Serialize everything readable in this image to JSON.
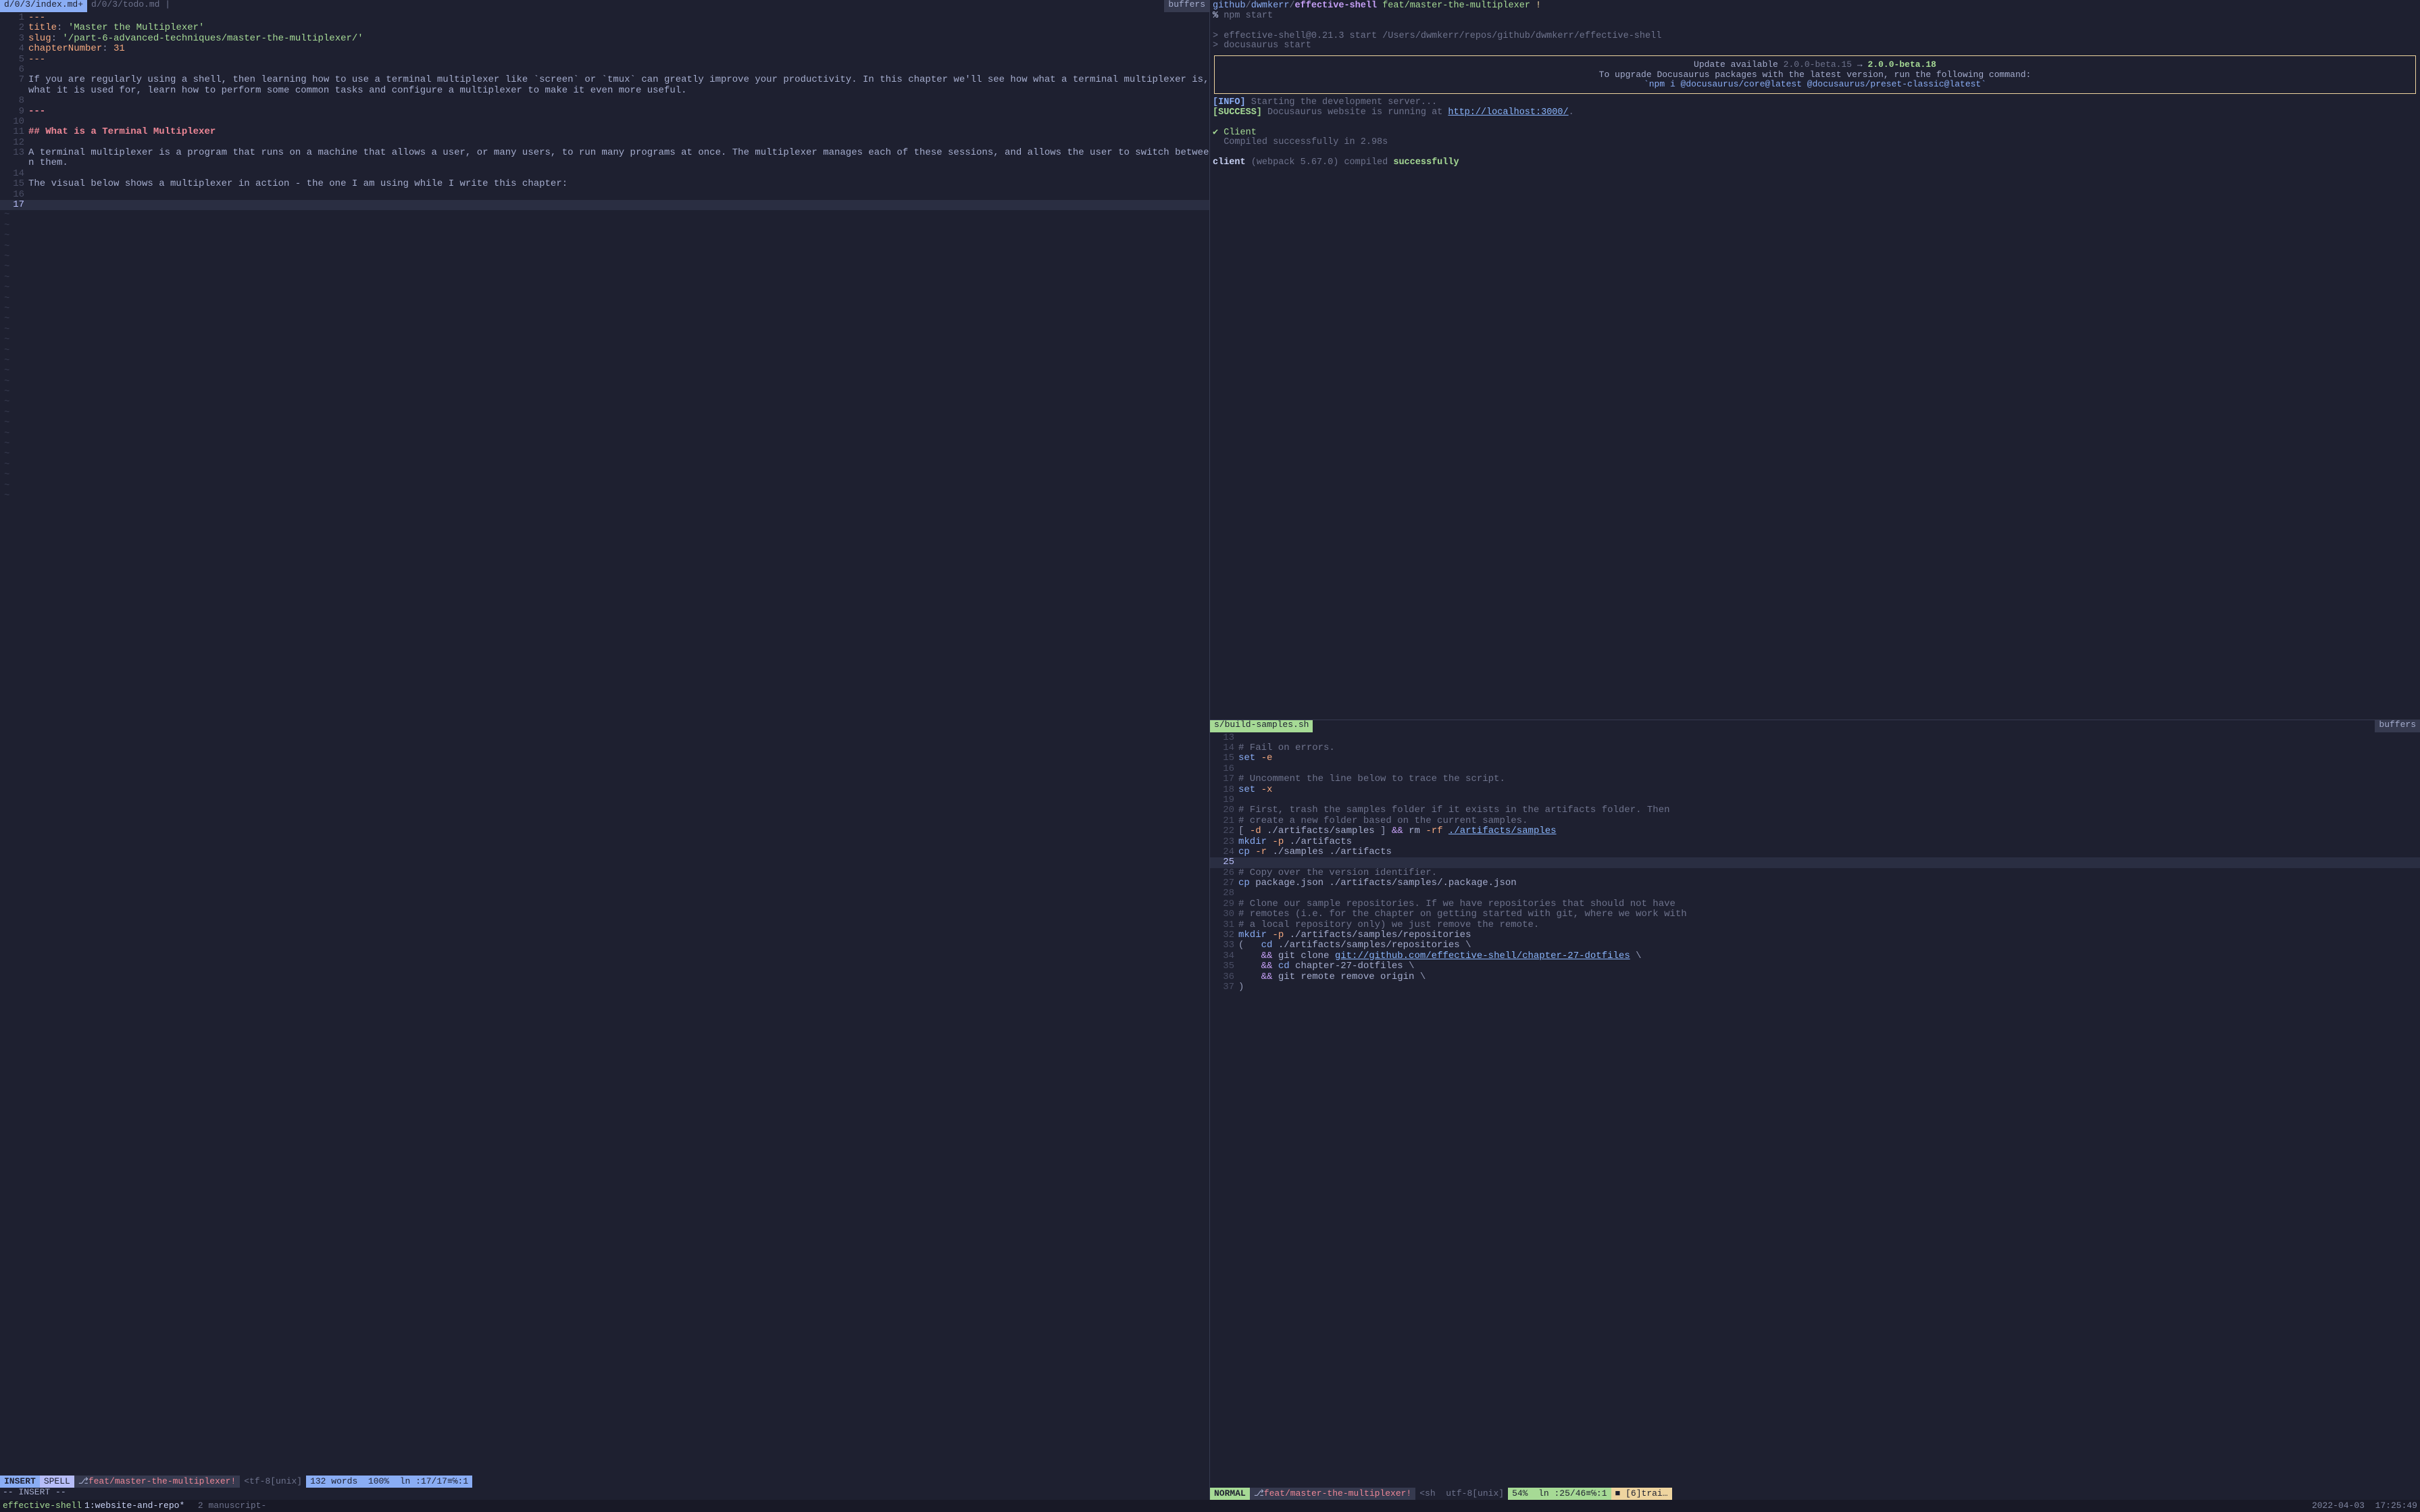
{
  "left": {
    "tabs": {
      "active": "d/0/3/index.md+",
      "other": "d/0/3/todo.md |",
      "right": "buffers"
    },
    "lines": [
      {
        "n": "1",
        "cur": false,
        "frags": [
          {
            "t": "---",
            "c": "key"
          }
        ]
      },
      {
        "n": "2",
        "cur": false,
        "frags": [
          {
            "t": "title",
            "c": "key"
          },
          {
            "t": ": ",
            "c": "pun"
          },
          {
            "t": "'Master the Multiplexer'",
            "c": "str"
          }
        ]
      },
      {
        "n": "3",
        "cur": false,
        "frags": [
          {
            "t": "slug",
            "c": "key"
          },
          {
            "t": ": ",
            "c": "pun"
          },
          {
            "t": "'/part-6-advanced-techniques/master-the-multiplexer/'",
            "c": "str"
          }
        ]
      },
      {
        "n": "4",
        "cur": false,
        "frags": [
          {
            "t": "chapterNumber",
            "c": "key"
          },
          {
            "t": ": ",
            "c": "pun"
          },
          {
            "t": "31",
            "c": "num"
          }
        ]
      },
      {
        "n": "5",
        "cur": false,
        "frags": [
          {
            "t": "---",
            "c": "key"
          }
        ]
      },
      {
        "n": "6",
        "cur": false,
        "frags": []
      },
      {
        "n": "7",
        "cur": false,
        "frags": [
          {
            "t": "If you are regularly using a shell, then learning how to use a terminal multiplexer like `screen` or `tmux` can greatly improve your productivity. In this chapter we'll see how what a terminal multiplexer is, what it is used for, learn how to perform some common tasks and configure a multiplexer to make it even more useful.",
            "c": ""
          }
        ]
      },
      {
        "n": "8",
        "cur": false,
        "frags": []
      },
      {
        "n": "9",
        "cur": false,
        "frags": [
          {
            "t": "---",
            "c": "hdr"
          }
        ]
      },
      {
        "n": "10",
        "cur": false,
        "frags": []
      },
      {
        "n": "11",
        "cur": false,
        "frags": [
          {
            "t": "## What is a Terminal Multiplexer",
            "c": "hdr"
          }
        ]
      },
      {
        "n": "12",
        "cur": false,
        "frags": []
      },
      {
        "n": "13",
        "cur": false,
        "frags": [
          {
            "t": "A terminal multiplexer is a program that runs on a machine that allows a user, or many users, to run many programs at once. The multiplexer manages each of these sessions, and allows the user to switch between them.",
            "c": ""
          }
        ]
      },
      {
        "n": "14",
        "cur": false,
        "frags": []
      },
      {
        "n": "15",
        "cur": false,
        "frags": [
          {
            "t": "The visual below shows a multiplexer in action - the one I am using while I write this chapter:",
            "c": ""
          }
        ]
      },
      {
        "n": "16",
        "cur": false,
        "frags": []
      },
      {
        "n": "17",
        "cur": true,
        "frags": []
      }
    ],
    "status": {
      "mode": "INSERT",
      "spell": "SPELL",
      "branch": "feat/master-the-multiplexer!",
      "enc": "<tf-8[unix]",
      "words": "132 words",
      "pct": "100%",
      "pos": "ln :17/17≡℅:1"
    },
    "cmdline": "-- INSERT --"
  },
  "term": {
    "path": [
      "github",
      "dwmkerr",
      "effective-shell"
    ],
    "branch": "feat/master-the-multiplexer",
    "dirty": "!",
    "cmd": "npm start",
    "out1": "> effective-shell@0.21.3 start /Users/dwmkerr/repos/github/dwmkerr/effective-shell",
    "out2": "> docusaurus start",
    "update": {
      "avail": "Update available",
      "old": "2.0.0-beta.15",
      "arrow": "→",
      "new": "2.0.0-beta.18",
      "msg": "To upgrade Docusaurus packages with the latest version, run the following command:",
      "cmd": "`npm i @docusaurus/core@latest @docusaurus/preset-classic@latest`"
    },
    "info": "[INFO]",
    "info_t": "Starting the development server...",
    "succ": "[SUCCESS]",
    "succ_t": "Docusaurus website is running at ",
    "url": "http://localhost:3000/",
    "client": "✔ Client",
    "compiled": "Compiled successfully in 2.98s",
    "final_a": "client ",
    "final_b": "(webpack 5.67.0)",
    "final_c": " compiled ",
    "final_d": "successfully"
  },
  "rb": {
    "tab": "s/build-samples.sh",
    "right": "buffers",
    "lines": [
      {
        "n": "13",
        "frags": []
      },
      {
        "n": "14",
        "frags": [
          {
            "t": "# Fail on errors.",
            "c": "cmt"
          }
        ]
      },
      {
        "n": "15",
        "frags": [
          {
            "t": "set ",
            "c": "cmd"
          },
          {
            "t": "-e",
            "c": "opt"
          }
        ]
      },
      {
        "n": "16",
        "frags": []
      },
      {
        "n": "17",
        "frags": [
          {
            "t": "# Uncomment the line below to trace the script.",
            "c": "cmt"
          }
        ]
      },
      {
        "n": "18",
        "frags": [
          {
            "t": "set ",
            "c": "cmd"
          },
          {
            "t": "-x",
            "c": "opt"
          }
        ]
      },
      {
        "n": "19",
        "frags": []
      },
      {
        "n": "20",
        "frags": [
          {
            "t": "# First, trash the samples folder if it exists in the artifacts folder. Then",
            "c": "cmt"
          }
        ]
      },
      {
        "n": "21",
        "frags": [
          {
            "t": "# create a new folder based on the current samples.",
            "c": "cmt"
          }
        ]
      },
      {
        "n": "22",
        "frags": [
          {
            "t": "[ ",
            "c": "pun"
          },
          {
            "t": "-d ",
            "c": "opt"
          },
          {
            "t": "./artifacts/samples ",
            "c": ""
          },
          {
            "t": "] ",
            "c": "pun"
          },
          {
            "t": "&& ",
            "c": "kw"
          },
          {
            "t": "rm ",
            "c": ""
          },
          {
            "t": "-rf ",
            "c": "opt"
          },
          {
            "t": "./artifacts/samples",
            "c": "path"
          }
        ]
      },
      {
        "n": "23",
        "frags": [
          {
            "t": "mkdir ",
            "c": "cmd"
          },
          {
            "t": "-p ",
            "c": "opt"
          },
          {
            "t": "./artifacts",
            "c": ""
          }
        ]
      },
      {
        "n": "24",
        "frags": [
          {
            "t": "cp ",
            "c": "cmd"
          },
          {
            "t": "-r ",
            "c": "opt"
          },
          {
            "t": "./samples ./artifacts",
            "c": ""
          }
        ]
      },
      {
        "n": "25",
        "cur": true,
        "frags": []
      },
      {
        "n": "26",
        "frags": [
          {
            "t": "# Copy over the version identifier.",
            "c": "cmt"
          }
        ]
      },
      {
        "n": "27",
        "frags": [
          {
            "t": "cp ",
            "c": "cmd"
          },
          {
            "t": "package.json ./artifacts/samples/.package.json",
            "c": ""
          }
        ]
      },
      {
        "n": "28",
        "frags": []
      },
      {
        "n": "29",
        "frags": [
          {
            "t": "# Clone our sample repositories. If we have repositories that should not have",
            "c": "cmt"
          }
        ]
      },
      {
        "n": "30",
        "frags": [
          {
            "t": "# remotes (i.e. for the chapter on getting started with git, where we work with",
            "c": "cmt"
          }
        ]
      },
      {
        "n": "31",
        "frags": [
          {
            "t": "# a local repository only) we just remove the remote.",
            "c": "cmt"
          }
        ]
      },
      {
        "n": "32",
        "frags": [
          {
            "t": "mkdir ",
            "c": "cmd"
          },
          {
            "t": "-p ",
            "c": "opt"
          },
          {
            "t": "./artifacts/samples/repositories",
            "c": ""
          }
        ]
      },
      {
        "n": "33",
        "frags": [
          {
            "t": "(   ",
            "c": "pun"
          },
          {
            "t": "cd ",
            "c": "cmd"
          },
          {
            "t": "./artifacts/samples/repositories ",
            "c": ""
          },
          {
            "t": "\\",
            "c": "pun"
          }
        ]
      },
      {
        "n": "34",
        "frags": [
          {
            "t": "    && ",
            "c": "kw"
          },
          {
            "t": "git clone ",
            "c": ""
          },
          {
            "t": "git://github.com/effective-shell/chapter-27-dotfiles",
            "c": "path"
          },
          {
            "t": " \\",
            "c": "pun"
          }
        ]
      },
      {
        "n": "35",
        "frags": [
          {
            "t": "    && ",
            "c": "kw"
          },
          {
            "t": "cd ",
            "c": "cmd"
          },
          {
            "t": "chapter-27-dotfiles ",
            "c": ""
          },
          {
            "t": "\\",
            "c": "pun"
          }
        ]
      },
      {
        "n": "36",
        "frags": [
          {
            "t": "    && ",
            "c": "kw"
          },
          {
            "t": "git remote remove origin ",
            "c": ""
          },
          {
            "t": "\\",
            "c": "pun"
          }
        ]
      },
      {
        "n": "37",
        "frags": [
          {
            "t": ")",
            "c": "pun"
          }
        ]
      }
    ],
    "status": {
      "mode": "NORMAL",
      "branch": "feat/master-the-multiplexer!",
      "ft": "<sh",
      "enc": "utf-8[unix]",
      "pct": "54%",
      "pos": "ln :25/46≡℅:1",
      "warn": "■ [6]trai…"
    }
  },
  "tmux": {
    "session": "effective-shell",
    "win1_n": "1:",
    "win1": "website-and-repo*",
    "win2_n": "2",
    "win2": "manuscript-",
    "date": "2022-04-03",
    "time": "17:25:49"
  }
}
